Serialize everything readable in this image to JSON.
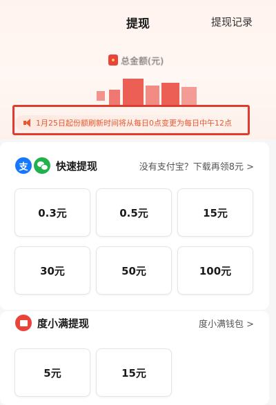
{
  "header": {
    "title": "提现",
    "record_link": "提现记录"
  },
  "balance": {
    "label": "总金额(元)",
    "amount_obscured": true
  },
  "notice": {
    "text": "1月25日起份额刷新时间将从每日0点变更为每日中午12点"
  },
  "quick_withdraw": {
    "title": "快速提现",
    "link": "没有支付宝？下载再领8元 >",
    "options": [
      "0.3元",
      "0.5元",
      "15元",
      "30元",
      "50元",
      "100元"
    ]
  },
  "duxiaoman_withdraw": {
    "title": "度小满提现",
    "link": "度小满钱包 >",
    "options": [
      "5元",
      "15元"
    ]
  },
  "colors": {
    "accent": "#e8443a",
    "notice_text": "#e9572f",
    "alipay": "#1677ff",
    "wechat": "#22b14c"
  },
  "icons": [
    "redpacket-icon",
    "speaker-icon",
    "alipay-icon",
    "wechat-icon",
    "duxiaoman-icon"
  ]
}
